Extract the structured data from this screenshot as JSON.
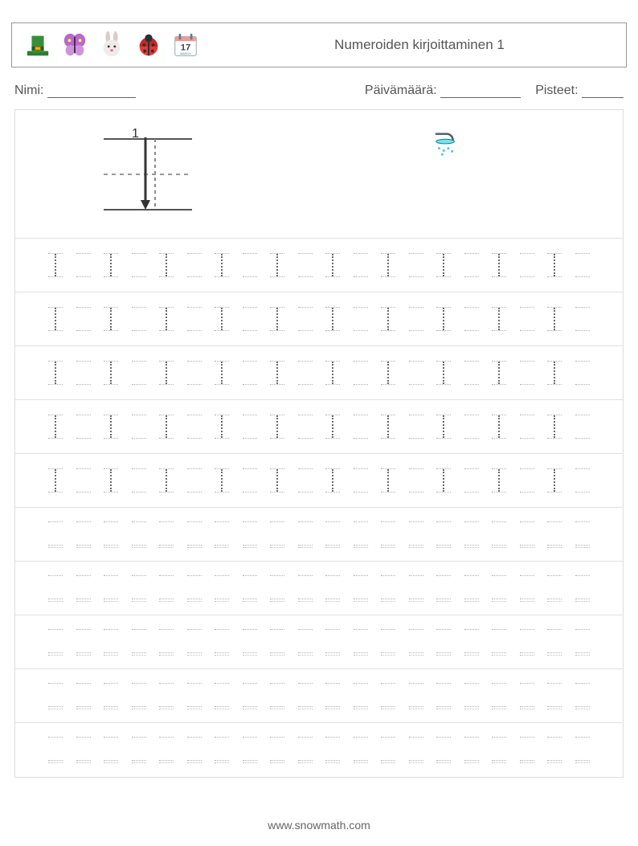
{
  "header": {
    "title": "Numeroiden kirjoittaminen 1",
    "icons": [
      "hat-icon",
      "butterfly-icon",
      "bunny-icon",
      "ladybug-icon",
      "calendar-icon"
    ],
    "calendar_day": "17",
    "calendar_month": "MARCH"
  },
  "labels": {
    "name": "Nimi:",
    "date": "Päivämäärä:",
    "score": "Pisteet:"
  },
  "demo": {
    "numeral": "1",
    "clipart": "shower-icon"
  },
  "practice": {
    "columns_per_row": 20,
    "traced_rows": 5,
    "blank_rows": 5,
    "trace_pattern": "alt",
    "trace_char": "1"
  },
  "footer": {
    "url": "www.snowmath.com"
  }
}
